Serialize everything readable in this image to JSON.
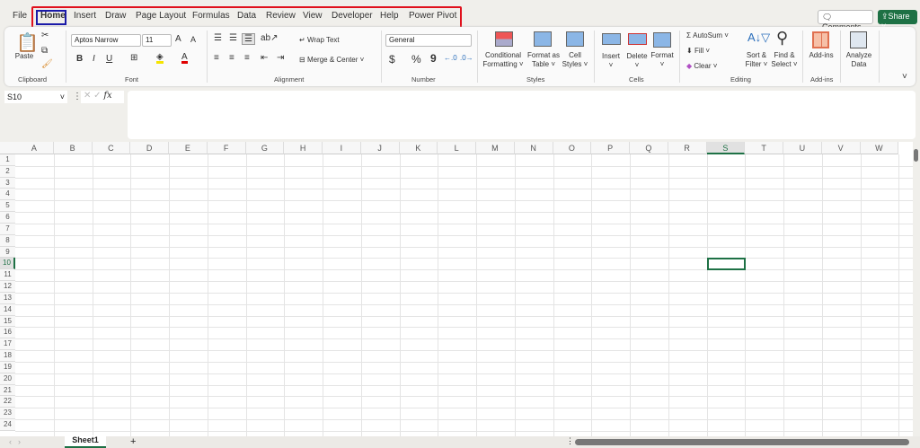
{
  "menu_tabs": [
    "File",
    "Home",
    "Insert",
    "Draw",
    "Page Layout",
    "Formulas",
    "Data",
    "Review",
    "View",
    "Developer",
    "Help",
    "Power Pivot"
  ],
  "active_tab": "Home",
  "top_right": {
    "comments": "Comments",
    "share": "Share"
  },
  "clipboard": {
    "paste": "Paste",
    "label": "Clipboard"
  },
  "font": {
    "name": "Aptos Narrow",
    "size": "11",
    "bold": "B",
    "italic": "I",
    "underline": "U",
    "label": "Font",
    "grow": "A",
    "shrink": "A",
    "color_glyph": "A",
    "accent_fill": "#f5e400",
    "accent_font": "#e00000"
  },
  "alignment": {
    "wrap": "Wrap Text",
    "merge": "Merge & Center",
    "label": "Alignment"
  },
  "number": {
    "format": "General",
    "currency": "$",
    "percent": "%",
    "comma": "9",
    "label": "Number"
  },
  "styles": {
    "conditional": [
      "Conditional",
      "Formatting"
    ],
    "format_table": [
      "Format as",
      "Table"
    ],
    "cell_styles": [
      "Cell",
      "Styles"
    ],
    "label": "Styles"
  },
  "cells": {
    "insert": "Insert",
    "delete": "Delete",
    "format": "Format",
    "label": "Cells"
  },
  "editing": {
    "autosum": "AutoSum",
    "fill": "Fill",
    "clear": "Clear",
    "sort": [
      "Sort &",
      "Filter"
    ],
    "find": [
      "Find &",
      "Select"
    ],
    "label": "Editing"
  },
  "addins": {
    "addins": "Add-ins",
    "label": "Add-ins"
  },
  "analyze": [
    "Analyze",
    "Data"
  ],
  "formula_bar": {
    "name_box": "S10",
    "value": "",
    "fx": "fx"
  },
  "columns": [
    "A",
    "B",
    "C",
    "D",
    "E",
    "F",
    "G",
    "H",
    "I",
    "J",
    "K",
    "L",
    "M",
    "N",
    "O",
    "P",
    "Q",
    "R",
    "S",
    "T",
    "U",
    "V",
    "W"
  ],
  "rows": [
    "1",
    "2",
    "3",
    "4",
    "5",
    "6",
    "7",
    "8",
    "9",
    "10",
    "11",
    "12",
    "13",
    "14",
    "15",
    "16",
    "17",
    "18",
    "19",
    "20",
    "21",
    "22",
    "23",
    "24"
  ],
  "selected_cell": "S10",
  "sheets": [
    "Sheet1"
  ],
  "add_sheet": "+"
}
